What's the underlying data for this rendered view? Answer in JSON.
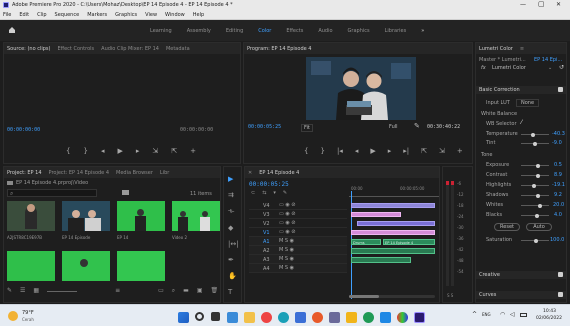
{
  "titlebar": {
    "title": "Adobe Premiere Pro 2020 - C:\\Users\\Mohaz\\Desktop\\EP 14 Episode 4 - EP 14 Episode 4 *",
    "minimize": "—",
    "maximize": "▢",
    "close": "✕"
  },
  "menu": [
    "File",
    "Edit",
    "Clip",
    "Sequence",
    "Markers",
    "Graphics",
    "View",
    "Window",
    "Help"
  ],
  "workspaces": [
    "Learning",
    "Assembly",
    "Editing",
    "Color",
    "Effects",
    "Audio",
    "Graphics",
    "Libraries",
    "»"
  ],
  "active_workspace": "Color",
  "source_panel": {
    "tabs": [
      "Source: (no clips)",
      "Effect Controls",
      "Audio Clip Mixer: EP 14",
      "Metadata"
    ],
    "tc_left": "00:00:00:00",
    "tc_right": "00:00:00:00"
  },
  "program_panel": {
    "tab": "Program: EP 14 Episode 4",
    "tc_left": "00:00:05:25",
    "fit": "Fit",
    "full": "Full",
    "tc_right": "00:30:40:22"
  },
  "project_panel": {
    "tabs": [
      "Project: EP 14",
      "Project: EP 14 Episode 4",
      "Media Browser",
      "Libr"
    ],
    "path": "EP 14 Episode 4.prproj\\Video",
    "count": "11 items",
    "items": [
      {
        "name": "A2JSTR8C19E97B",
        "dur": "1:18"
      },
      {
        "name": "EP 14 Episode",
        "dur": "1:14:18"
      },
      {
        "name": "EP 14",
        "dur": "1:00"
      },
      {
        "name": "Video 2",
        "dur": "1:00"
      }
    ]
  },
  "timeline": {
    "tab": "EP 14 Episode 4",
    "tc": "00:00:05:25",
    "ruler": [
      "00:00",
      "00:00:05:00"
    ],
    "tracks": [
      "V4",
      "V3",
      "V2",
      "V1",
      "A1",
      "A2",
      "A3",
      "A4"
    ],
    "audio_clip_labels": [
      "Drums",
      "EP 14 Episode 4"
    ]
  },
  "meter_labels": [
    "-6",
    "-12",
    "-18",
    "-24",
    "-30",
    "-36",
    "-42",
    "-48",
    "-54"
  ],
  "meter_footer": "S S",
  "lumetri": {
    "tabs": [
      "Lumetri Color",
      "≡"
    ],
    "master": "Master * Lumetri...",
    "clip": "EP 14 Epi...",
    "fx": "fx",
    "effect_name": "Lumetri Color",
    "basic_correction": "Basic Correction",
    "input_lut": "Input LUT",
    "input_lut_value": "None",
    "white_balance": "White Balance",
    "wb_selector": "WB Selector",
    "temperature": {
      "label": "Temperature",
      "value": "-40.3"
    },
    "tint": {
      "label": "Tint",
      "value": "-9.0"
    },
    "tone": "Tone",
    "exposure": {
      "label": "Exposure",
      "value": "0.5"
    },
    "contrast": {
      "label": "Contrast",
      "value": "8.9"
    },
    "highlights": {
      "label": "Highlights",
      "value": "-19.1"
    },
    "shadows": {
      "label": "Shadows",
      "value": "9.2"
    },
    "whites": {
      "label": "Whites",
      "value": "20.0"
    },
    "blacks": {
      "label": "Blacks",
      "value": "4.0"
    },
    "reset": "Reset",
    "auto": "Auto",
    "saturation": {
      "label": "Saturation",
      "value": "100.0"
    },
    "creative": "Creative",
    "curves": "Curves"
  },
  "taskbar": {
    "weather_temp": "79°F",
    "weather_desc": "Cerah",
    "time": "10:43",
    "date": "02/06/2022",
    "lang": "ENG"
  }
}
